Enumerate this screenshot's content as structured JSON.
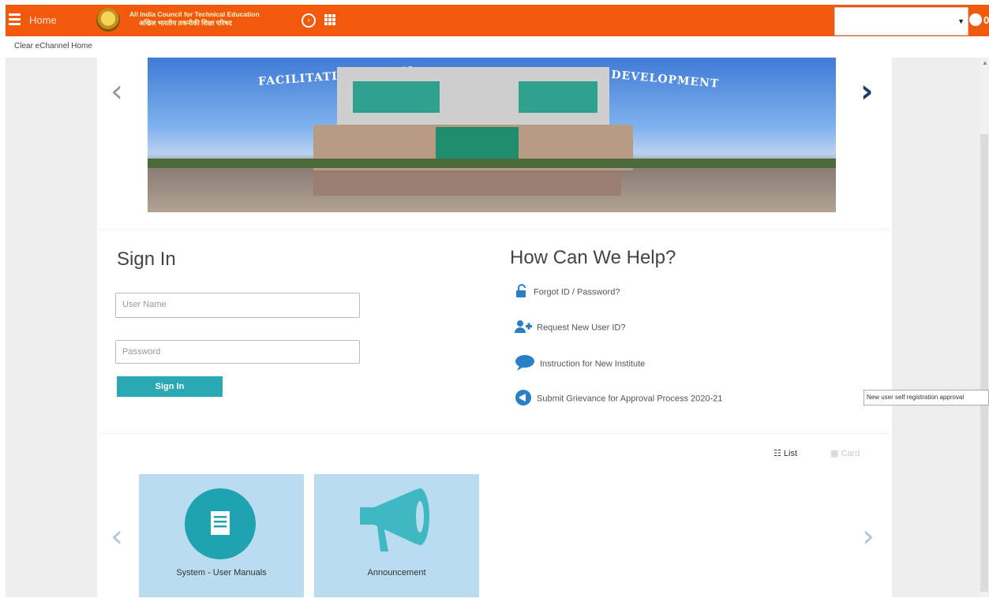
{
  "header": {
    "home_label": "Home",
    "org_line1": "All India Council for Technical Education",
    "org_line2": "अखिल भारतीय तकनीकी शिक्षा परिषद",
    "notification_count": "0",
    "language_select_value": ""
  },
  "breadcrumb": "Clear eChannel Home",
  "banner": {
    "text_left": "FACILITATING TECHN",
    "text_right": "OTE DEVELOPMENT"
  },
  "signin": {
    "title": "Sign In",
    "username_placeholder": "User Name",
    "password_placeholder": "Password",
    "button_label": "Sign In"
  },
  "help": {
    "title": "How Can We Help?",
    "items": [
      {
        "label": "Forgot ID / Password?",
        "icon": "unlock-icon"
      },
      {
        "label": "Request New User ID?",
        "icon": "add-user-icon"
      },
      {
        "label": "Instruction for New Institute",
        "icon": "chat-bubble-icon"
      },
      {
        "label": "Submit Grievance for Approval Process 2020-21",
        "icon": "megaphone-icon"
      }
    ]
  },
  "tooltip": "New user self registration approval",
  "view_toggle": {
    "list": "List",
    "card": "Card"
  },
  "tiles": [
    {
      "label": "System - User Manuals",
      "icon": "document-icon"
    },
    {
      "label": "Announcement",
      "icon": "megaphone-icon"
    }
  ],
  "colors": {
    "topbar": "#f15a0c",
    "accent": "#2aa8b3",
    "tile": "#b9dcf0",
    "link": "#2a80c6"
  }
}
